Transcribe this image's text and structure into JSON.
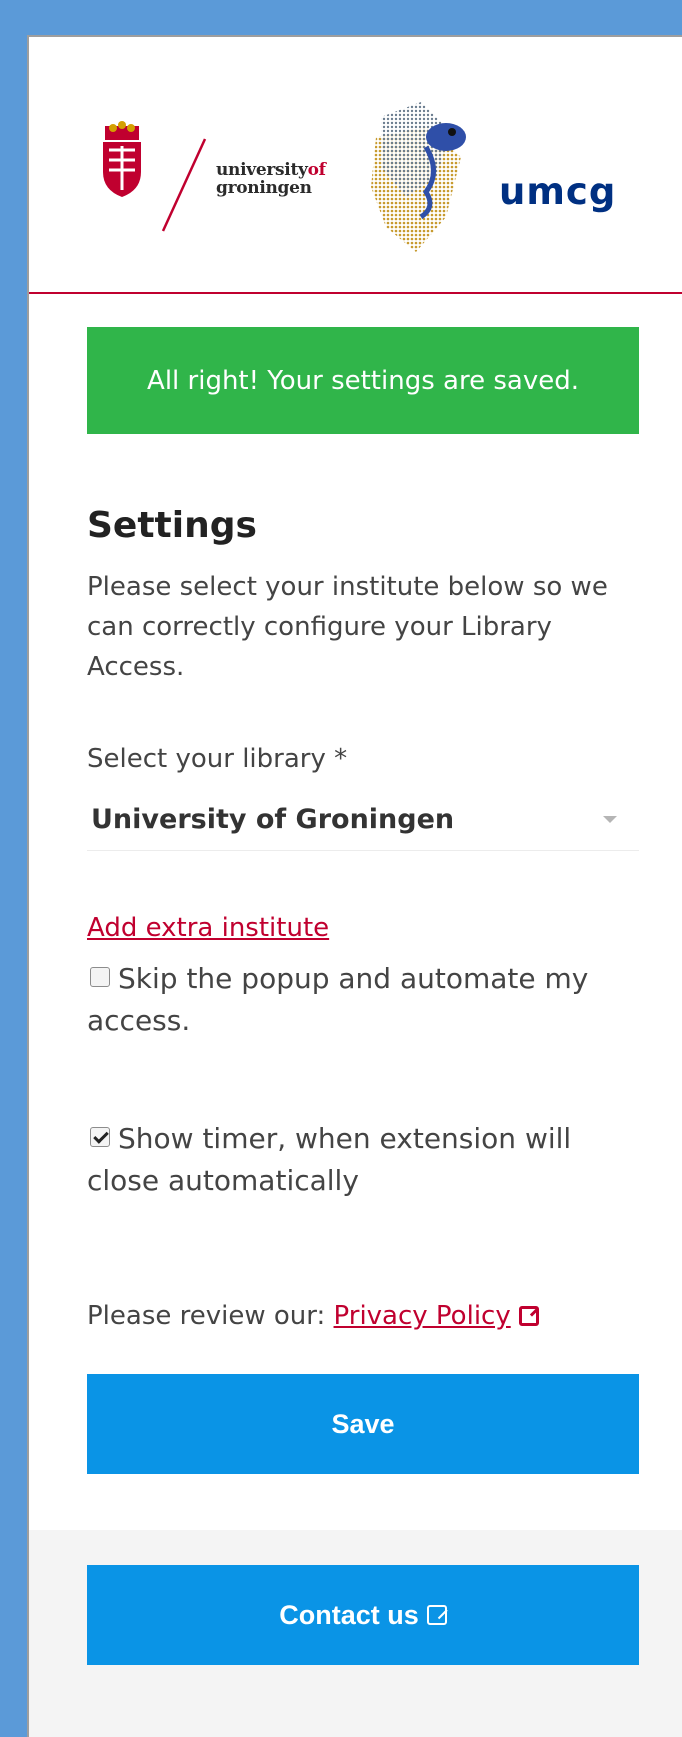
{
  "header": {
    "uni_logo_line1": "university",
    "uni_logo_of": "of",
    "uni_logo_line2": "groningen",
    "umcg_logo": "umcg"
  },
  "alert": {
    "message": "All right! Your settings are saved.",
    "color": "#30b54a"
  },
  "settings": {
    "title": "Settings",
    "description": "Please select your institute below so we can correctly configure your Library Access.",
    "select_label": "Select your library *",
    "selected_library": "University of Groningen",
    "add_institute_link": "Add extra institute",
    "skip_popup_label": "Skip the popup and automate my access.",
    "skip_popup_checked": false,
    "show_timer_label": "Show timer, when extension will close automatically",
    "show_timer_checked": true,
    "privacy_prefix": "Please review our:",
    "privacy_link": "Privacy Policy",
    "save_button": "Save"
  },
  "footer": {
    "contact_button": "Contact us"
  },
  "colors": {
    "accent_red": "#c0002f",
    "button_blue": "#0a94e6",
    "umcg_blue": "#003082"
  }
}
